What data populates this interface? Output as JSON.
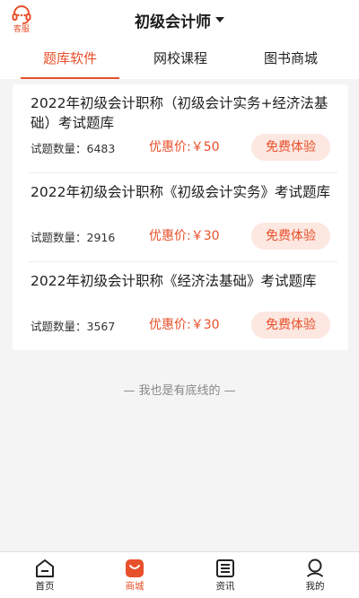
{
  "header": {
    "customer_service_label": "客服",
    "title": "初级会计师"
  },
  "tabs": [
    {
      "label": "题库软件",
      "active": true
    },
    {
      "label": "网校课程",
      "active": false
    },
    {
      "label": "图书商城",
      "active": false
    }
  ],
  "products": [
    {
      "title": "2022年初级会计职称（初级会计实务+经济法基础）考试题库",
      "count": "试题数量：6483",
      "price": "优惠价:￥50",
      "button": "免费体验"
    },
    {
      "title": "2022年初级会计职称《初级会计实务》考试题库",
      "count": "试题数量：2916",
      "price": "优惠价:￥30",
      "button": "免费体验"
    },
    {
      "title": "2022年初级会计职称《经济法基础》考试题库",
      "count": "试题数量：3567",
      "price": "优惠价:￥30",
      "button": "免费体验"
    }
  ],
  "end_note": "— 我也是有底线的 —",
  "bottom_nav": [
    {
      "label": "首页",
      "icon": "home-icon",
      "active": false
    },
    {
      "label": "商城",
      "icon": "shop-bag-icon",
      "active": true
    },
    {
      "label": "资讯",
      "icon": "news-icon",
      "active": false
    },
    {
      "label": "我的",
      "icon": "profile-icon",
      "active": false
    }
  ],
  "colors": {
    "accent": "#e8502b",
    "button_bg": "#fde7e1",
    "page_bg": "#f4f4f4"
  }
}
